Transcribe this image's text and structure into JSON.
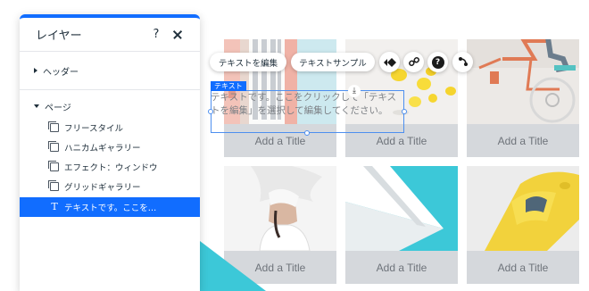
{
  "layers_panel": {
    "title": "レイヤー",
    "help_label": "?",
    "header_section": "ヘッダー",
    "page_section": "ページ",
    "items": [
      {
        "label": "フリースタイル",
        "icon": "gallery-icon"
      },
      {
        "label": "ハニカムギャラリー",
        "icon": "gallery-icon"
      },
      {
        "label": "エフェクト：ウィンドウ",
        "icon": "gallery-icon"
      },
      {
        "label": "グリッドギャラリー",
        "icon": "gallery-icon"
      },
      {
        "label": "テキストです。ここを…",
        "icon": "text-icon",
        "selected": true
      }
    ]
  },
  "toolbar": {
    "edit_text": "テキストを編集",
    "text_sample": "テキストサンプル",
    "animation_icon": "animation-icon",
    "link_icon": "link-icon",
    "help_icon": "help-icon",
    "connect_icon": "connect-icon"
  },
  "text_element": {
    "tag": "テキスト",
    "content": "テキストです。ここをクリックして「テキストを編集」を選択して編集してください。"
  },
  "gallery": {
    "captions": [
      "Add a Title",
      "Add a Title",
      "Add a Title",
      "Add a Title",
      "Add a Title",
      "Add a Title"
    ]
  },
  "colors": {
    "accent": "#116dff",
    "caption_bg": "#d5d8dc",
    "caption_text": "#6e737a"
  }
}
